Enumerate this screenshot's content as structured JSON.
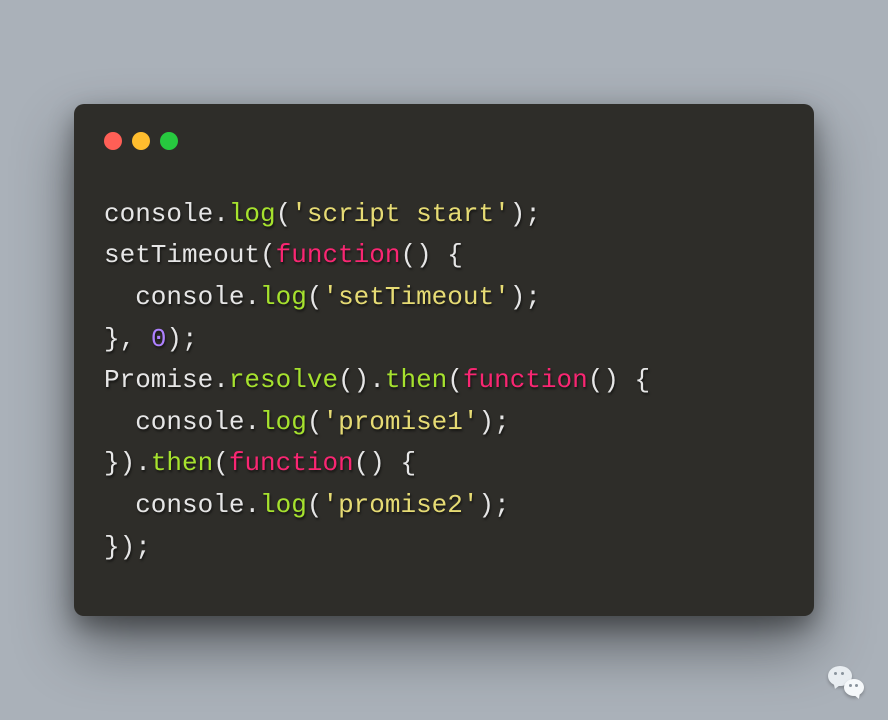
{
  "code": {
    "lines": [
      [
        {
          "t": "console",
          "c": "tok-default"
        },
        {
          "t": ".",
          "c": "tok-punct"
        },
        {
          "t": "log",
          "c": "tok-method"
        },
        {
          "t": "(",
          "c": "tok-punct"
        },
        {
          "t": "'script start'",
          "c": "tok-string"
        },
        {
          "t": ");",
          "c": "tok-punct"
        }
      ],
      [
        {
          "t": "setTimeout",
          "c": "tok-default"
        },
        {
          "t": "(",
          "c": "tok-punct"
        },
        {
          "t": "function",
          "c": "tok-keyword"
        },
        {
          "t": "() {",
          "c": "tok-punct"
        }
      ],
      [
        {
          "t": "  console",
          "c": "tok-default"
        },
        {
          "t": ".",
          "c": "tok-punct"
        },
        {
          "t": "log",
          "c": "tok-method"
        },
        {
          "t": "(",
          "c": "tok-punct"
        },
        {
          "t": "'setTimeout'",
          "c": "tok-string"
        },
        {
          "t": ");",
          "c": "tok-punct"
        }
      ],
      [
        {
          "t": "}, ",
          "c": "tok-punct"
        },
        {
          "t": "0",
          "c": "tok-num"
        },
        {
          "t": ");",
          "c": "tok-punct"
        }
      ],
      [
        {
          "t": "Promise",
          "c": "tok-default"
        },
        {
          "t": ".",
          "c": "tok-punct"
        },
        {
          "t": "resolve",
          "c": "tok-method"
        },
        {
          "t": "().",
          "c": "tok-punct"
        },
        {
          "t": "then",
          "c": "tok-method"
        },
        {
          "t": "(",
          "c": "tok-punct"
        },
        {
          "t": "function",
          "c": "tok-keyword"
        },
        {
          "t": "() {",
          "c": "tok-punct"
        }
      ],
      [
        {
          "t": "  console",
          "c": "tok-default"
        },
        {
          "t": ".",
          "c": "tok-punct"
        },
        {
          "t": "log",
          "c": "tok-method"
        },
        {
          "t": "(",
          "c": "tok-punct"
        },
        {
          "t": "'promise1'",
          "c": "tok-string"
        },
        {
          "t": ");",
          "c": "tok-punct"
        }
      ],
      [
        {
          "t": "}).",
          "c": "tok-punct"
        },
        {
          "t": "then",
          "c": "tok-method"
        },
        {
          "t": "(",
          "c": "tok-punct"
        },
        {
          "t": "function",
          "c": "tok-keyword"
        },
        {
          "t": "() {",
          "c": "tok-punct"
        }
      ],
      [
        {
          "t": "  console",
          "c": "tok-default"
        },
        {
          "t": ".",
          "c": "tok-punct"
        },
        {
          "t": "log",
          "c": "tok-method"
        },
        {
          "t": "(",
          "c": "tok-punct"
        },
        {
          "t": "'promise2'",
          "c": "tok-string"
        },
        {
          "t": ");",
          "c": "tok-punct"
        }
      ],
      [
        {
          "t": "});",
          "c": "tok-punct"
        }
      ]
    ]
  }
}
